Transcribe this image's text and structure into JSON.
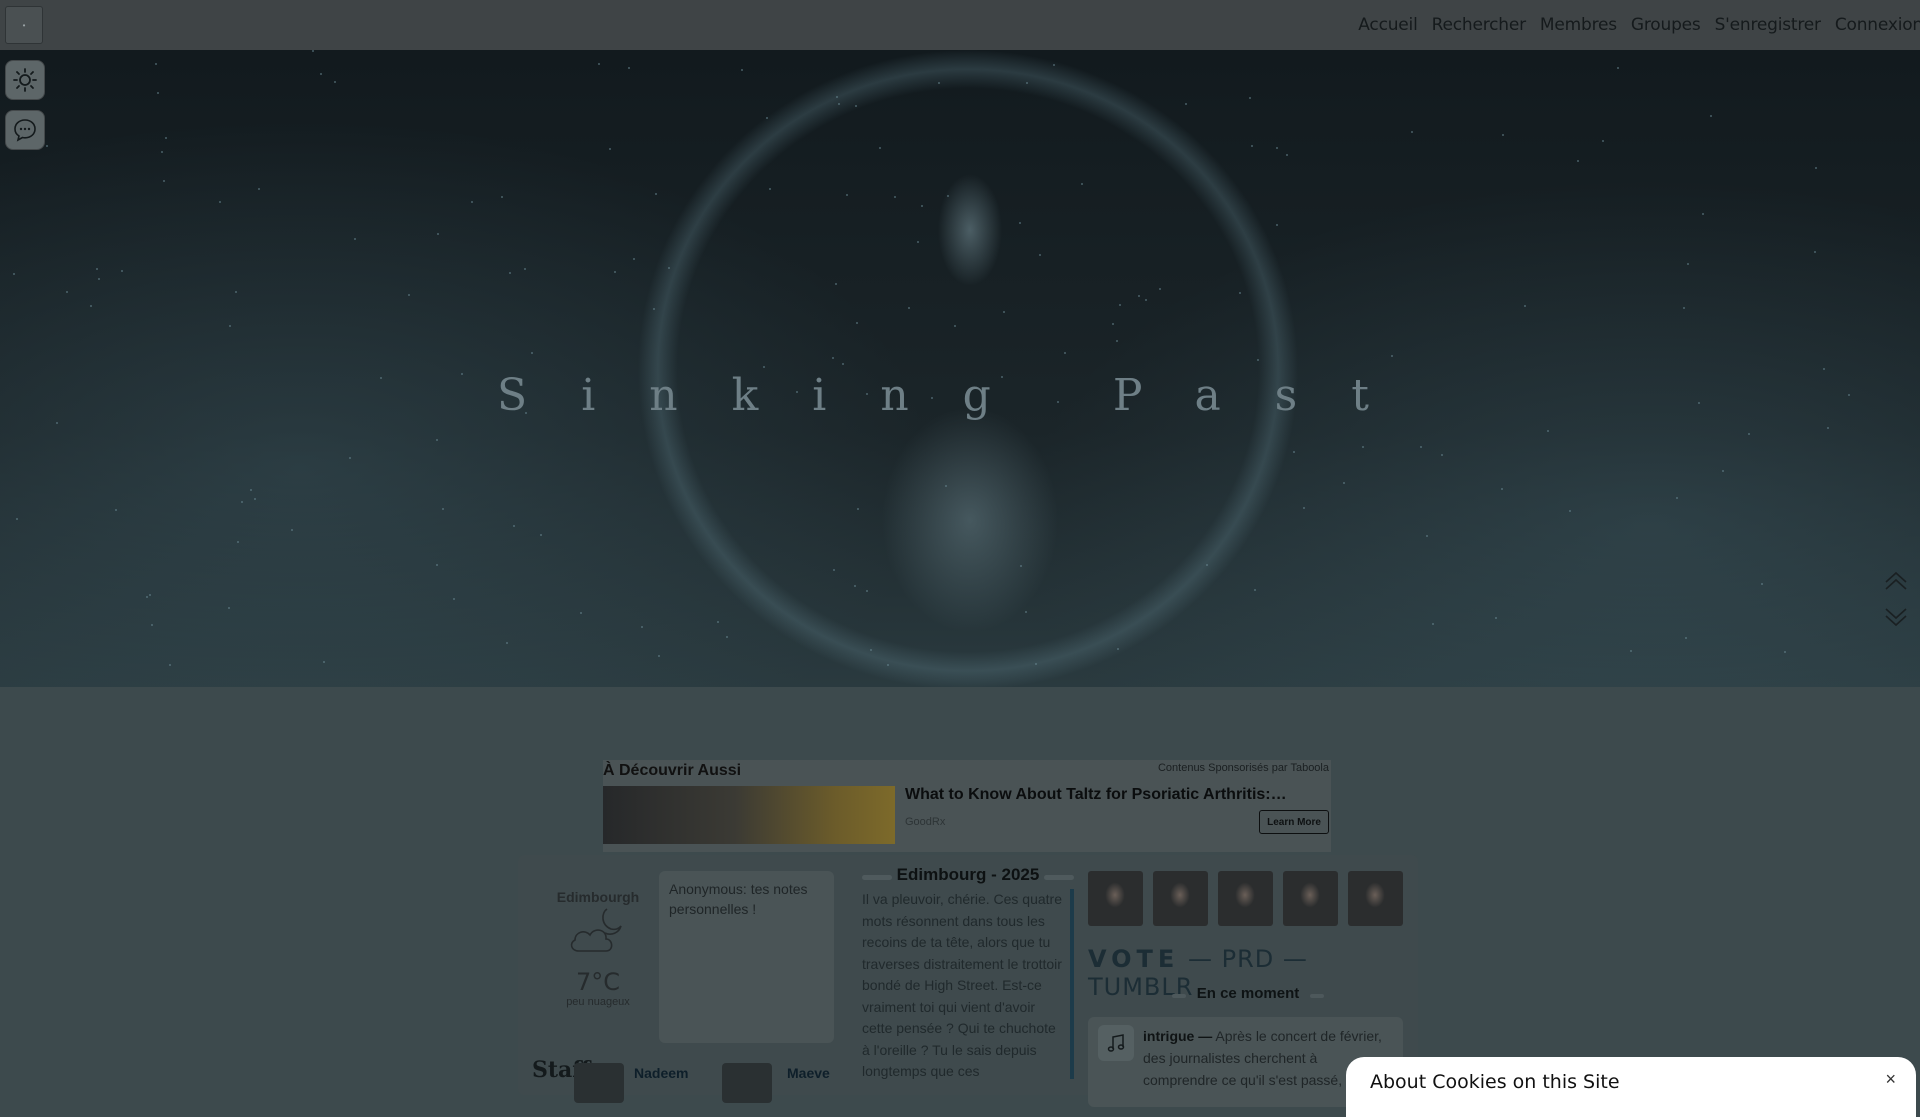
{
  "topbar": {
    "home_glyph": "•",
    "nav": [
      "Accueil",
      "Rechercher",
      "Membres",
      "Groupes",
      "S'enregistrer",
      "Connexion"
    ]
  },
  "hero": {
    "title": "Sinking Past"
  },
  "taboola": {
    "heading": "À Découvrir Aussi",
    "sponsor": "Contenus Sponsorisés par Taboola",
    "ad_title": "What to Know About Taltz for Psoriatic Arthritis:…",
    "ad_brand": "GoodRx",
    "ad_button": "Learn More"
  },
  "weather": {
    "city": "Edimbourgh",
    "temp": "7°C",
    "desc": "peu nuageux"
  },
  "notes": {
    "text": "Anonymous: tes notes personnelles !"
  },
  "staff": {
    "label": "Staff",
    "members": [
      "Nadeem",
      "Maeve"
    ]
  },
  "story": {
    "heading": "Edimbourg - 2025",
    "body": "Il va pleuvoir, chérie. Ces quatre mots résonnent dans tous les recoins de ta tête, alors que tu traverses distraitement le trottoir bondé de High Street. Est-ce vraiment toi qui vient d'avoir cette pensée ? Qui te chuchote à l'oreille ? Tu le sais depuis longtemps que ces"
  },
  "vote": {
    "vote": "VOTE",
    "prd": "— PRD —",
    "tumblr": "TUMBLR"
  },
  "moment": {
    "label": "En ce moment",
    "tag": "intrigue —",
    "text": "Après le concert de février, des journalistes cherchent à comprendre ce qu'il s'est passé, en ce"
  },
  "cookie": {
    "title": "About Cookies on this Site",
    "close": "×"
  },
  "colors": {
    "overlay_bg": "#3d4a4d",
    "accent_blue": "#1d3b4a"
  }
}
